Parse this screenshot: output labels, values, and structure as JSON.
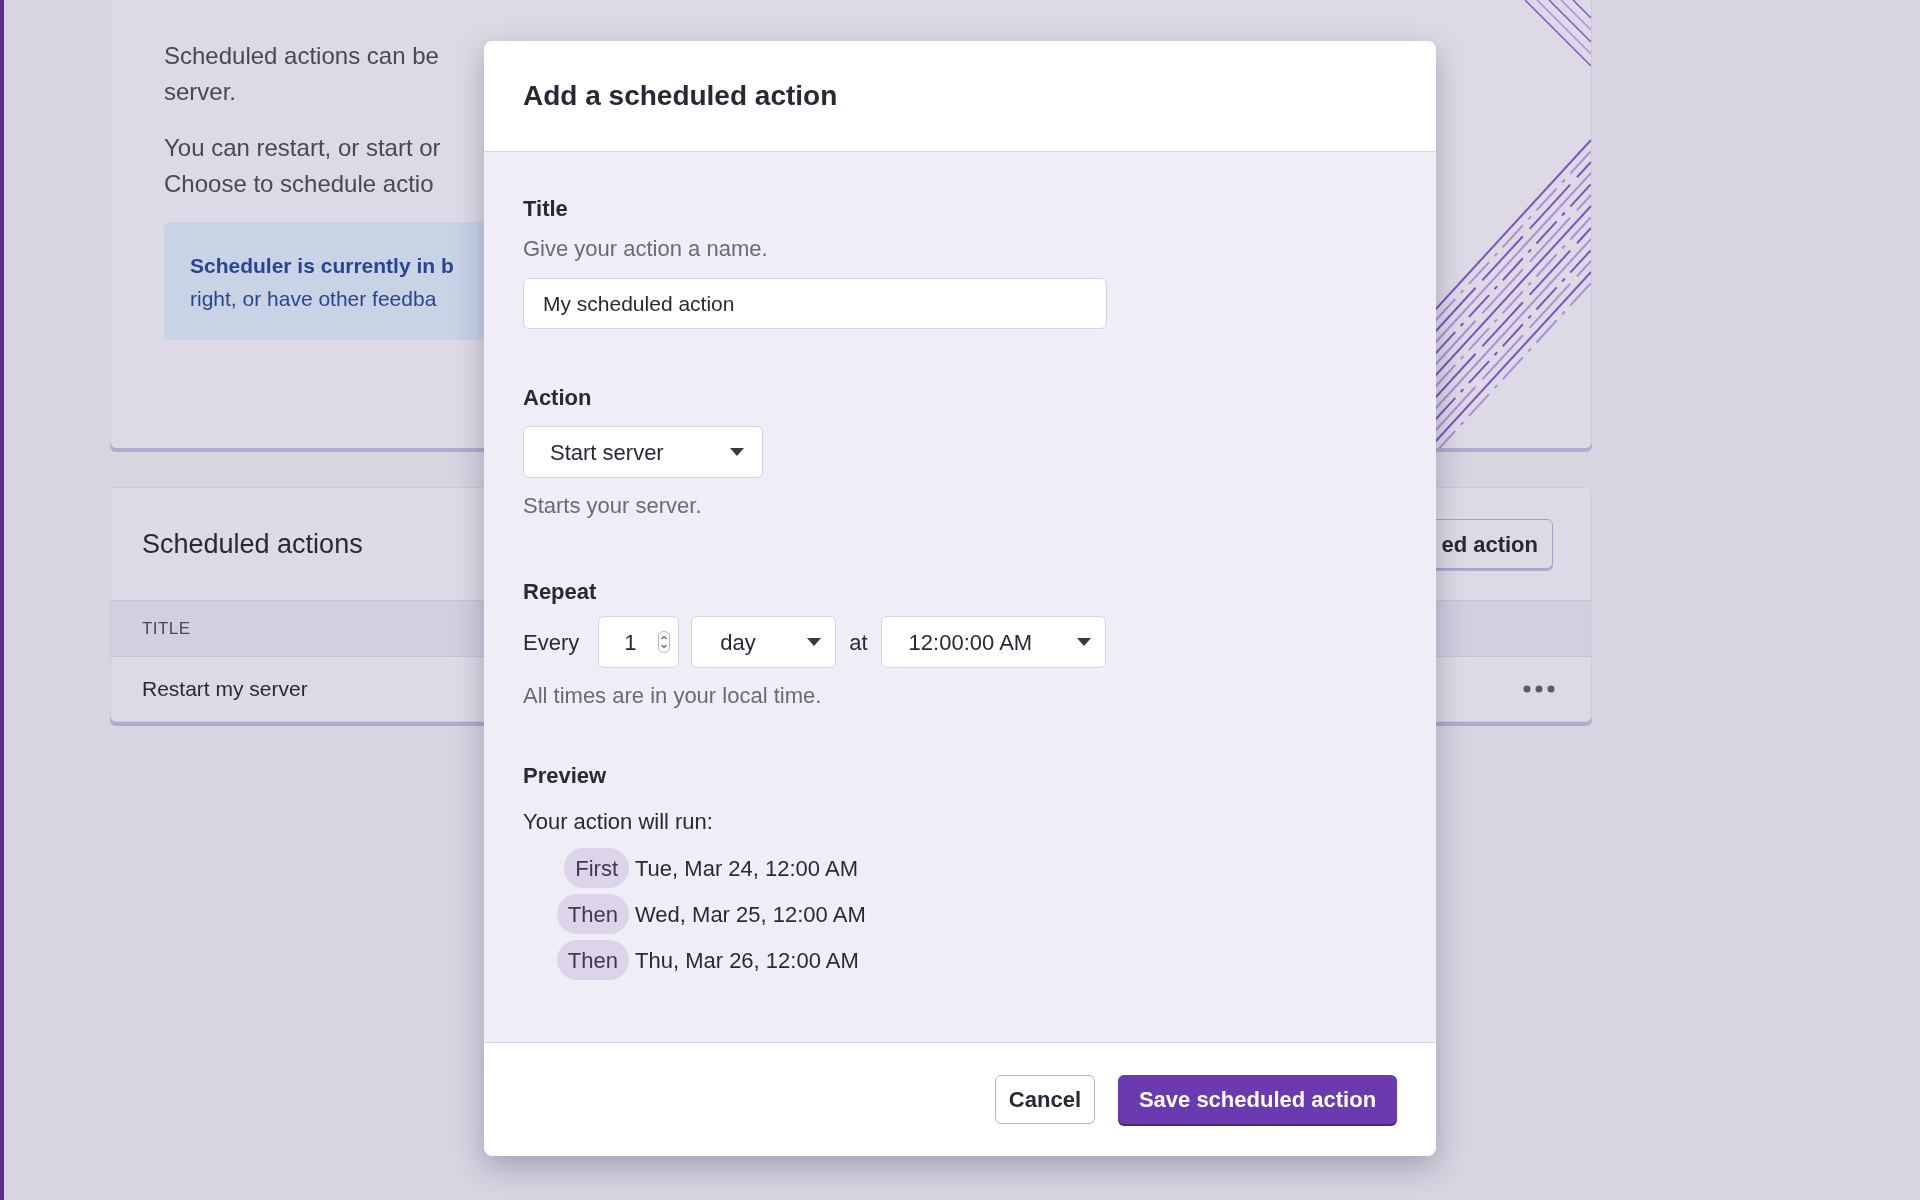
{
  "scheduler_card": {
    "paragraphs": [
      [
        "Scheduled actions can be",
        "server."
      ],
      [
        "You can restart, or start or",
        "Choose to schedule actio"
      ]
    ],
    "notice": [
      {
        "text": "Scheduler is currently in b",
        "bold": true
      },
      {
        "text": "right, or have other feedba",
        "bold": false
      }
    ]
  },
  "scheduled_actions_card": {
    "title": "Scheduled actions",
    "button": "ed action",
    "columns": [
      "TITLE"
    ],
    "rows": [
      {
        "title": "Restart my server"
      }
    ]
  },
  "modal": {
    "title": "Add a scheduled action",
    "title_field": {
      "label": "Title",
      "hint": "Give your action a name.",
      "value": "My scheduled action"
    },
    "action_field": {
      "label": "Action",
      "value": "Start server",
      "hint": "Starts your server."
    },
    "repeat": {
      "label": "Repeat",
      "every_label": "Every",
      "count": "1",
      "unit": "day",
      "at_label": "at",
      "time": "12:00:00 AM",
      "hint": "All times are in your local time."
    },
    "preview": {
      "label": "Preview",
      "intro": "Your action will run:",
      "runs": [
        {
          "tag": "First",
          "when": "Tue, Mar 24, 12:00 AM"
        },
        {
          "tag": "Then",
          "when": "Wed, Mar 25, 12:00 AM"
        },
        {
          "tag": "Then",
          "when": "Thu, Mar 26, 12:00 AM"
        }
      ]
    },
    "buttons": [
      {
        "label": "Cancel",
        "kind": "secondary"
      },
      {
        "label": "Save scheduled action",
        "kind": "primary"
      }
    ]
  }
}
